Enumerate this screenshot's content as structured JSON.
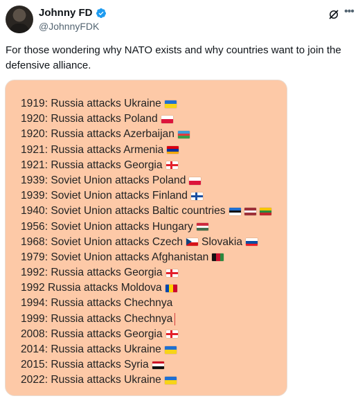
{
  "author": {
    "name": "Johnny FD",
    "handle": "@JohnnyFDK",
    "verified": true
  },
  "icons": {
    "grok": "grok-icon",
    "more": "more-options-icon",
    "verified": "verified-badge-icon"
  },
  "tweet": {
    "text": "For those wondering why NATO exists and why countries want to join the defensive alliance."
  },
  "media": {
    "background": "#fdc9a7",
    "lines": [
      {
        "text": "1919: Russia attacks Ukraine",
        "flags": [
          "ukraine"
        ]
      },
      {
        "text": "1920: Russia attacks Poland",
        "flags": [
          "poland"
        ]
      },
      {
        "text": "1920: Russia attacks Azerbaijan",
        "flags": [
          "azerbaijan"
        ]
      },
      {
        "text": "1921: Russia attacks Armenia",
        "flags": [
          "armenia"
        ]
      },
      {
        "text": "1921: Russia attacks Georgia",
        "flags": [
          "georgia"
        ]
      },
      {
        "text": "1939: Soviet Union attacks Poland",
        "flags": [
          "poland"
        ]
      },
      {
        "text": "1939: Soviet Union attacks Finland",
        "flags": [
          "finland"
        ]
      },
      {
        "text": "1940: Soviet Union attacks Baltic countries",
        "flags": [
          "estonia",
          "latvia",
          "lithuania"
        ]
      },
      {
        "text": "1956: Soviet Union attacks Hungary",
        "flags": [
          "hungary"
        ]
      },
      {
        "text": "1968: Soviet Union attacks Czech",
        "flags": [
          "czech"
        ],
        "suffix": "Slovakia",
        "suffix_flags": [
          "slovakia"
        ]
      },
      {
        "text": "1979: Soviet Union attacks Afghanistan",
        "flags": [
          "afghanistan"
        ]
      },
      {
        "text": "1992: Russia attacks Georgia",
        "flags": [
          "georgia"
        ]
      },
      {
        "text": "1992  Russia attacks Moldova",
        "flags": [
          "moldova"
        ]
      },
      {
        "text": "1994: Russia attacks Chechnya",
        "flags": []
      },
      {
        "text": "1999: Russia attacks Chechnya",
        "flags": [],
        "cursor": true
      },
      {
        "text": "2008: Russia attacks Georgia",
        "flags": [
          "georgia"
        ]
      },
      {
        "text": "2014: Russia attacks Ukraine",
        "flags": [
          "ukraine"
        ]
      },
      {
        "text": "2015: Russia attacks Syria",
        "flags": [
          "syria"
        ]
      },
      {
        "text": "2022: Russia attacks Ukraine",
        "flags": [
          "ukraine"
        ]
      }
    ]
  },
  "flag_colors": {
    "ukraine": {
      "dir": "h",
      "stripes": [
        "#1f6fd1",
        "#f7d417"
      ]
    },
    "poland": {
      "dir": "h",
      "stripes": [
        "#ffffff",
        "#dc143c"
      ]
    },
    "azerbaijan": {
      "dir": "h",
      "stripes": [
        "#3f9cd8",
        "#e03a3e",
        "#3a9d4a"
      ]
    },
    "armenia": {
      "dir": "h",
      "stripes": [
        "#d90012",
        "#0033a0",
        "#f2a800"
      ]
    },
    "georgia": {
      "dir": "cross",
      "stripes": [
        "#ffffff",
        "#e3202b"
      ]
    },
    "finland": {
      "dir": "cross",
      "stripes": [
        "#ffffff",
        "#1b4fa0"
      ]
    },
    "estonia": {
      "dir": "h",
      "stripes": [
        "#1f6fd1",
        "#111111",
        "#ffffff"
      ]
    },
    "latvia": {
      "dir": "h",
      "stripes": [
        "#9e3039",
        "#ffffff",
        "#9e3039"
      ]
    },
    "lithuania": {
      "dir": "h",
      "stripes": [
        "#f7c600",
        "#2a8a3e",
        "#c1272d"
      ]
    },
    "hungary": {
      "dir": "h",
      "stripes": [
        "#cd2a3e",
        "#ffffff",
        "#436f4d"
      ]
    },
    "czech": {
      "dir": "czech",
      "stripes": [
        "#ffffff",
        "#d7141a",
        "#11457e"
      ]
    },
    "slovakia": {
      "dir": "h",
      "stripes": [
        "#ffffff",
        "#0b4ea2",
        "#ee1c25"
      ]
    },
    "afghanistan": {
      "dir": "v",
      "stripes": [
        "#111111",
        "#c8102e",
        "#2a8a3e"
      ]
    },
    "moldova": {
      "dir": "v",
      "stripes": [
        "#0046ae",
        "#ffd200",
        "#cc092f"
      ]
    },
    "syria": {
      "dir": "h",
      "stripes": [
        "#ce1126",
        "#ffffff",
        "#111111"
      ]
    }
  }
}
